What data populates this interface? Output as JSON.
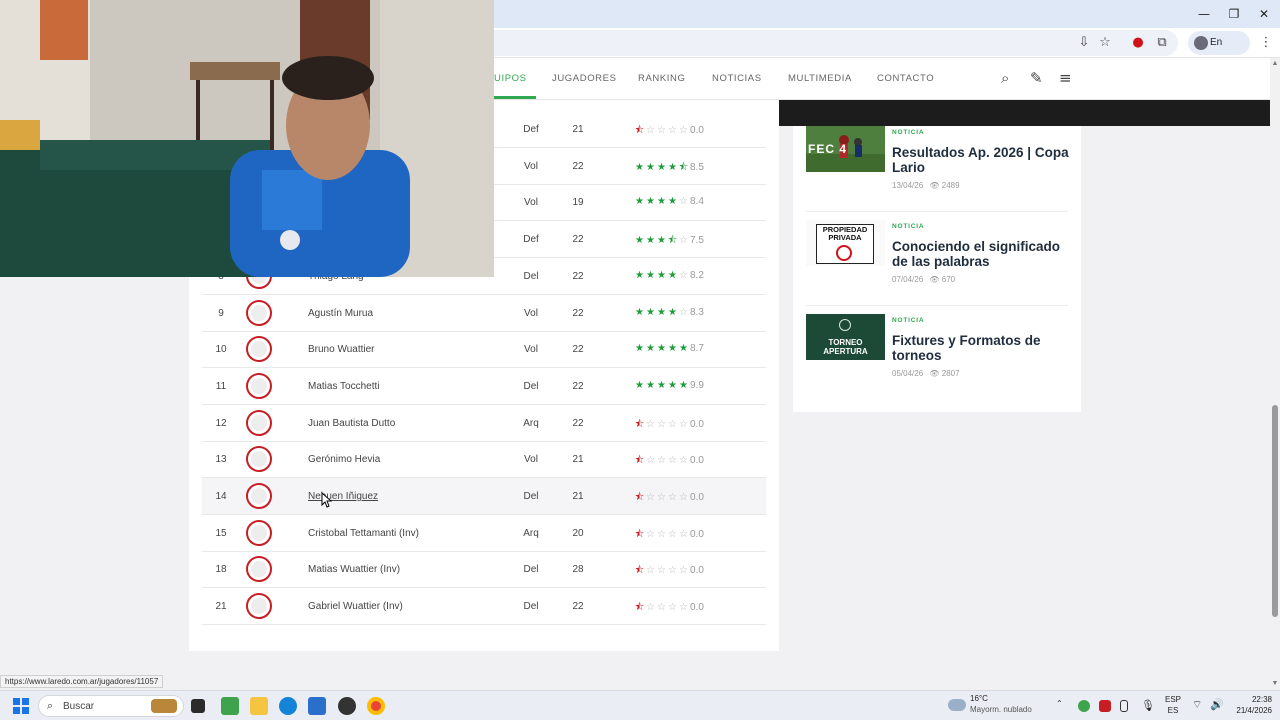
{
  "window": {
    "minimize": "—",
    "restore": "❐",
    "close": "✕"
  },
  "browser": {
    "profile_label": "En pausa",
    "status_url": "https://www.laredo.com.ar/jugadores/11057"
  },
  "nav": {
    "items": [
      {
        "label": "UIPOS",
        "active": true
      },
      {
        "label": "JUGADORES",
        "active": false
      },
      {
        "label": "RANKING",
        "active": false
      },
      {
        "label": "NOTICIAS",
        "active": false
      },
      {
        "label": "MULTIMEDIA",
        "active": false
      },
      {
        "label": "CONTACTO",
        "active": false
      }
    ],
    "accent_color": "#2fa84f"
  },
  "players_table": {
    "rows": [
      {
        "num": "",
        "name": "",
        "pos": "Def",
        "pj": "21",
        "stars": "r0000",
        "score": "0.0"
      },
      {
        "num": "",
        "name": "",
        "pos": "Vol",
        "pj": "22",
        "stars": "ggggh",
        "score": "8.5"
      },
      {
        "num": "",
        "name": "",
        "pos": "Vol",
        "pj": "19",
        "stars": "gggge",
        "score": "8.4"
      },
      {
        "num": "",
        "name": "",
        "pos": "Def",
        "pj": "22",
        "stars": "ggghe",
        "score": "7.5"
      },
      {
        "num": "8",
        "name": "Thiago Lang",
        "pos": "Del",
        "pj": "22",
        "stars": "gggge",
        "score": "8.2"
      },
      {
        "num": "9",
        "name": "Agustín Murua",
        "pos": "Vol",
        "pj": "22",
        "stars": "gggge",
        "score": "8.3"
      },
      {
        "num": "10",
        "name": "Bruno Wuattier",
        "pos": "Vol",
        "pj": "22",
        "stars": "ggggg",
        "score": "8.7"
      },
      {
        "num": "11",
        "name": "Matias Tocchetti",
        "pos": "Del",
        "pj": "22",
        "stars": "ggggg",
        "score": "9.9"
      },
      {
        "num": "12",
        "name": "Juan Bautista Dutto",
        "pos": "Arq",
        "pj": "22",
        "stars": "r0000",
        "score": "0.0"
      },
      {
        "num": "13",
        "name": "Gerónimo Hevia",
        "pos": "Vol",
        "pj": "21",
        "stars": "r0000",
        "score": "0.0"
      },
      {
        "num": "14",
        "name": "Nehuen Iñiguez",
        "pos": "Del",
        "pj": "21",
        "stars": "r0000",
        "score": "0.0"
      },
      {
        "num": "15",
        "name": "Cristobal Tettamanti (Inv)",
        "pos": "Arq",
        "pj": "20",
        "stars": "r0000",
        "score": "0.0"
      },
      {
        "num": "18",
        "name": "Matias Wuattier (Inv)",
        "pos": "Del",
        "pj": "28",
        "stars": "r0000",
        "score": "0.0"
      },
      {
        "num": "21",
        "name": "Gabriel Wuattier (Inv)",
        "pos": "Del",
        "pj": "22",
        "stars": "r0000",
        "score": "0.0"
      }
    ]
  },
  "news": [
    {
      "tag": "NOTICIA",
      "title": "Resultados Ap. 2026 | Copa Lario",
      "date": "13/04/26",
      "views": "2489",
      "thumb_text": "FEC  4"
    },
    {
      "tag": "NOTICIA",
      "title": "Conociendo el significado de las palabras",
      "date": "07/04/26",
      "views": "670",
      "thumb_text": "PROPIEDAD PRIVADA"
    },
    {
      "tag": "NOTICIA",
      "title": "Fixtures y Formatos de torneos",
      "date": "05/04/26",
      "views": "2807",
      "thumb_text": "TORNEO APERTURA"
    }
  ],
  "taskbar": {
    "search_label": "Buscar",
    "weather_temp": "16°C",
    "weather_desc": "Mayorm. nublado",
    "lang_top": "ESP",
    "lang_bottom": "ES",
    "time": "22:38",
    "date": "21/4/2026"
  }
}
